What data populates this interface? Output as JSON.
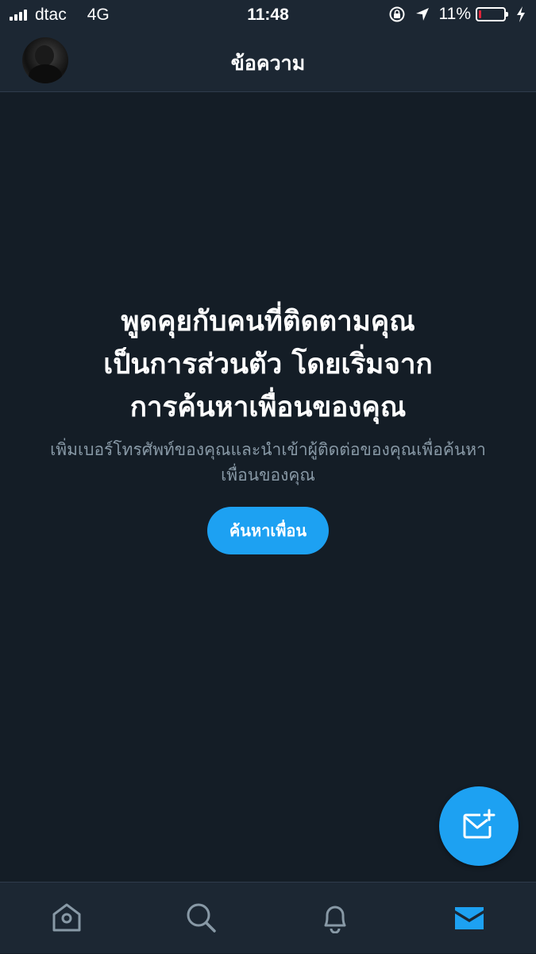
{
  "status_bar": {
    "carrier": "dtac",
    "network": "4G",
    "time": "11:48",
    "battery_percent": "11%",
    "battery_level": 0.11,
    "battery_color": "#e0243a"
  },
  "header": {
    "title": "ข้อความ",
    "avatar_icon": "profile-avatar"
  },
  "empty_state": {
    "title": "พูดคุยกับคนที่ติดตามคุณเป็นการส่วนตัว โดยเริ่มจากการค้นหาเพื่อนของคุณ",
    "subtitle": "เพิ่มเบอร์โทรศัพท์ของคุณและนำเข้าผู้ติดต่อของคุณเพื่อค้นหาเพื่อนของคุณ",
    "button_label": "ค้นหาเพื่อน"
  },
  "fab": {
    "icon": "new-message-icon"
  },
  "tab_bar": {
    "tabs": [
      {
        "icon": "home-icon",
        "active": false
      },
      {
        "icon": "search-icon",
        "active": false
      },
      {
        "icon": "notifications-icon",
        "active": false
      },
      {
        "icon": "messages-icon",
        "active": true
      }
    ]
  },
  "colors": {
    "background": "#141d26",
    "bar_background": "#1c2733",
    "accent": "#1da1f2",
    "secondary_text": "#8899a6",
    "inactive_icon": "#8899a6"
  }
}
